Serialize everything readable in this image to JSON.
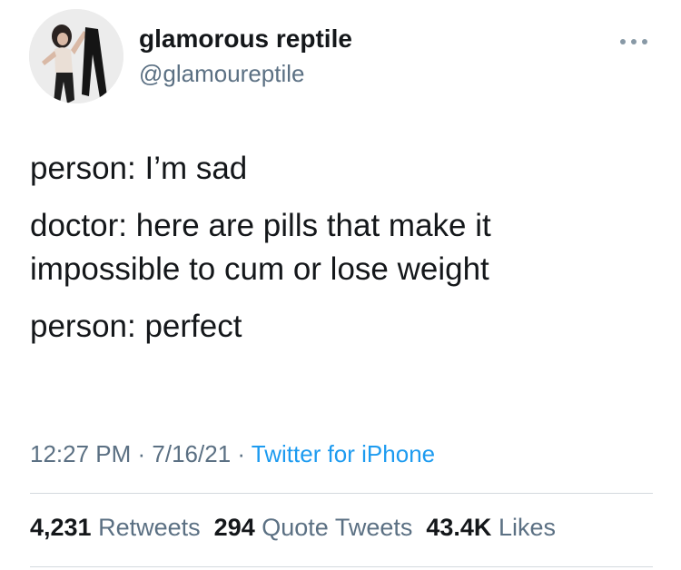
{
  "user": {
    "display_name": "glamorous reptile",
    "handle": "@glamoureptile",
    "avatar_icon": "avatar-photo"
  },
  "menu_icon": "more-dots-icon",
  "tweet": {
    "paragraphs": [
      "person: I’m sad",
      "doctor: here are pills that make it\nimpossible to cum or lose weight",
      "person: perfect"
    ]
  },
  "meta": {
    "time": "12:27 PM",
    "sep1": " · ",
    "date": "7/16/21",
    "sep2": " · ",
    "source": "Twitter for iPhone"
  },
  "stats": {
    "retweets": {
      "count": "4,231",
      "label": "Retweets"
    },
    "quotes": {
      "count": "294",
      "label": "Quote Tweets"
    },
    "likes": {
      "count": "43.4K",
      "label": "Likes"
    }
  },
  "colors": {
    "text": "#14171a",
    "secondary": "#5b7083",
    "link": "#1d9bf0",
    "divider": "#d4d9de"
  }
}
